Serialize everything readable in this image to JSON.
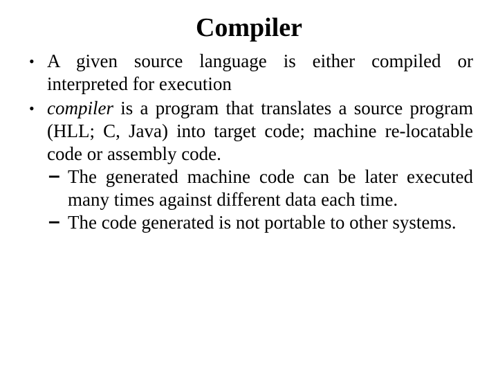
{
  "title": "Compiler",
  "bullets": {
    "b1": "A given source language is either compiled or interpreted for execution",
    "b2_word": "compiler",
    "b2_rest": " is a program that translates a source program (HLL; C, Java) into target code; machine re-locatable code or assembly code.",
    "sub1": "The generated machine code can be later executed many times against different data each time.",
    "sub2": "The code generated is not portable to other systems."
  }
}
